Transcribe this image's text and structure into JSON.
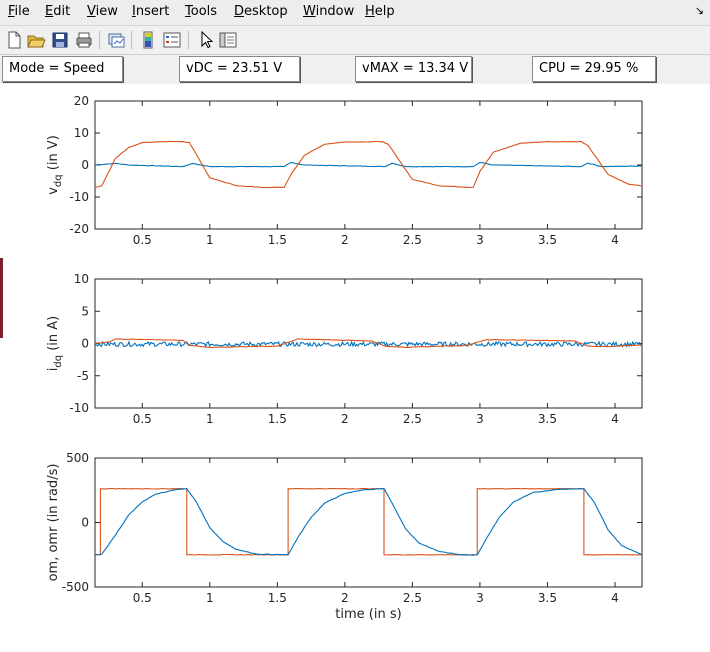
{
  "menu": {
    "items": [
      {
        "ul": "F",
        "rest": "ile"
      },
      {
        "ul": "E",
        "rest": "dit"
      },
      {
        "ul": "V",
        "rest": "iew"
      },
      {
        "ul": "I",
        "rest": "nsert"
      },
      {
        "ul": "T",
        "rest": "ools"
      },
      {
        "ul": "D",
        "rest": "esktop"
      },
      {
        "ul": "W",
        "rest": "indow"
      },
      {
        "ul": "H",
        "rest": "elp"
      }
    ]
  },
  "toolbar": {
    "icons": [
      "new-figure-icon",
      "open-file-icon",
      "save-icon",
      "print-icon",
      "link-plot-icon",
      "colorbar-icon",
      "legend-icon",
      "pointer-icon",
      "property-inspector-icon"
    ]
  },
  "status": {
    "mode": "Mode = Speed",
    "vdc": "vDC = 23.51 V",
    "vmax": "vMAX = 13.34 V",
    "cpu": "CPU = 29.95 %"
  },
  "colors": {
    "series_blue": "#0072BD",
    "series_orange": "#D95319"
  },
  "chart_data": [
    {
      "type": "line",
      "ylabel_main": "v",
      "ylabel_sub": "dq",
      "ylabel_unit": " (in V)",
      "xlabel": "",
      "xlim": [
        0.15,
        4.2
      ],
      "ylim": [
        -20,
        20
      ],
      "xticks": [
        "0.5",
        "1",
        "1.5",
        "2",
        "2.5",
        "3",
        "3.5",
        "4"
      ],
      "yticks": [
        "20",
        "10",
        "0",
        "-10",
        "-20"
      ],
      "series": [
        {
          "color": "#0072BD",
          "x": [
            0.15,
            0.3,
            0.4,
            0.8,
            0.87,
            1.0,
            1.55,
            1.6,
            1.7,
            2.3,
            2.35,
            2.45,
            2.95,
            3.0,
            3.1,
            3.75,
            3.8,
            3.9,
            4.2
          ],
          "y": [
            0,
            0.5,
            0,
            -0.5,
            0.5,
            -0.5,
            -0.5,
            0.8,
            0,
            -0.5,
            0.6,
            -0.5,
            -0.5,
            0.8,
            0,
            -0.5,
            0.6,
            -0.5,
            -0.3
          ]
        },
        {
          "color": "#D95319",
          "x": [
            0.15,
            0.2,
            0.3,
            0.4,
            0.5,
            0.65,
            0.8,
            0.85,
            1.0,
            1.2,
            1.4,
            1.55,
            1.6,
            1.7,
            1.85,
            2.0,
            2.28,
            2.32,
            2.5,
            2.7,
            2.95,
            3.0,
            3.1,
            3.3,
            3.5,
            3.75,
            3.8,
            3.95,
            4.1,
            4.2
          ],
          "y": [
            -7,
            -6.5,
            2,
            5.5,
            7,
            7.3,
            7.3,
            7,
            -4,
            -6.5,
            -7,
            -7,
            -3,
            3,
            6.5,
            7.2,
            7.3,
            6.5,
            -4.5,
            -6.5,
            -7,
            -2,
            4,
            6.8,
            7.3,
            7.3,
            6,
            -3,
            -6,
            -6.5
          ]
        }
      ]
    },
    {
      "type": "line",
      "ylabel_main": "i",
      "ylabel_sub": "dq",
      "ylabel_unit": " (in A)",
      "xlabel": "",
      "xlim": [
        0.15,
        4.2
      ],
      "ylim": [
        -10,
        10
      ],
      "xticks": [
        "0.5",
        "1",
        "1.5",
        "2",
        "2.5",
        "3",
        "3.5",
        "4"
      ],
      "yticks": [
        "10",
        "5",
        "0",
        "-5",
        "-10"
      ],
      "series": [
        {
          "color": "#0072BD",
          "x": [
            0.15,
            4.2
          ],
          "y": [
            -0.1,
            -0.1
          ],
          "noise": 0.35
        },
        {
          "color": "#D95319",
          "x": [
            0.15,
            0.25,
            0.3,
            0.8,
            0.85,
            1.0,
            1.5,
            1.6,
            1.65,
            2.2,
            2.3,
            2.45,
            2.9,
            3.0,
            3.05,
            3.7,
            3.8,
            3.95,
            4.2
          ],
          "y": [
            0,
            0.2,
            0.7,
            0.5,
            -0.3,
            -0.6,
            -0.4,
            0.3,
            0.7,
            0.4,
            -0.4,
            -0.6,
            -0.3,
            0.3,
            0.6,
            0.4,
            -0.4,
            -0.5,
            -0.2
          ]
        }
      ]
    },
    {
      "type": "line",
      "ylabel_main": "om, omr (in rad/s)",
      "ylabel_sub": "",
      "ylabel_unit": "",
      "xlabel": "time (in s)",
      "xlim": [
        0.15,
        4.2
      ],
      "ylim": [
        -500,
        500
      ],
      "xticks": [
        "0.5",
        "1",
        "1.5",
        "2",
        "2.5",
        "3",
        "3.5",
        "4"
      ],
      "yticks": [
        "500",
        "0",
        "-500"
      ],
      "series": [
        {
          "color": "#D95319",
          "x": [
            0.15,
            0.19,
            0.19,
            0.83,
            0.83,
            1.58,
            1.58,
            2.29,
            2.29,
            2.98,
            2.98,
            3.77,
            3.77,
            4.2
          ],
          "y": [
            -250,
            -250,
            262,
            262,
            -250,
            -250,
            262,
            262,
            -250,
            -250,
            262,
            262,
            -250,
            -250
          ]
        },
        {
          "color": "#0072BD",
          "x": [
            0.15,
            0.2,
            0.3,
            0.4,
            0.5,
            0.6,
            0.75,
            0.83,
            0.9,
            1.0,
            1.1,
            1.2,
            1.35,
            1.58,
            1.65,
            1.75,
            1.85,
            2.0,
            2.15,
            2.29,
            2.35,
            2.45,
            2.55,
            2.7,
            2.85,
            2.98,
            3.05,
            3.15,
            3.25,
            3.4,
            3.6,
            3.77,
            3.85,
            3.95,
            4.05,
            4.2
          ],
          "y": [
            -250,
            -245,
            -100,
            60,
            160,
            220,
            255,
            262,
            160,
            -40,
            -150,
            -210,
            -245,
            -250,
            -120,
            40,
            150,
            225,
            255,
            262,
            150,
            -50,
            -160,
            -225,
            -250,
            -252,
            -120,
            50,
            160,
            235,
            258,
            262,
            150,
            -60,
            -180,
            -250
          ]
        }
      ]
    }
  ]
}
